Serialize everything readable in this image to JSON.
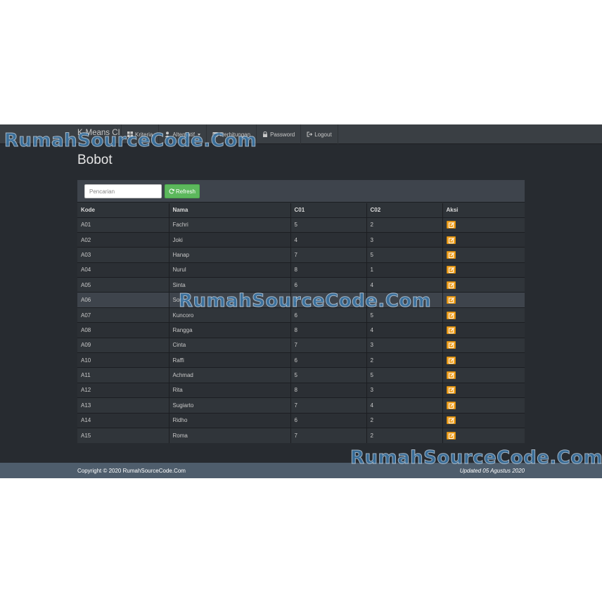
{
  "navbar": {
    "brand": "K-Means CI",
    "items": [
      {
        "label": "Kriteria",
        "icon": "th-large-icon"
      },
      {
        "label": "Alternatif",
        "icon": "user-icon",
        "dropdown": true
      },
      {
        "label": "Perhitungan",
        "icon": "calendar-icon"
      },
      {
        "label": "Password",
        "icon": "lock-icon"
      },
      {
        "label": "Logout",
        "icon": "logout-icon"
      }
    ]
  },
  "page": {
    "title": "Bobot"
  },
  "toolbar": {
    "search_placeholder": "Pencarian",
    "refresh_label": "Refresh"
  },
  "table": {
    "headers": [
      "Kode",
      "Nama",
      "C01",
      "C02",
      "Aksi"
    ],
    "rows": [
      [
        "A01",
        "Fachri",
        "5",
        "2"
      ],
      [
        "A02",
        "Joki",
        "4",
        "3"
      ],
      [
        "A03",
        "Hanap",
        "7",
        "5"
      ],
      [
        "A04",
        "Nurul",
        "8",
        "1"
      ],
      [
        "A05",
        "Sinta",
        "6",
        "4"
      ],
      [
        "A06",
        "Sony",
        "8",
        "2"
      ],
      [
        "A07",
        "Kuncoro",
        "6",
        "5"
      ],
      [
        "A08",
        "Rangga",
        "8",
        "4"
      ],
      [
        "A09",
        "Cinta",
        "7",
        "3"
      ],
      [
        "A10",
        "Raffi",
        "6",
        "2"
      ],
      [
        "A11",
        "Achmad",
        "5",
        "5"
      ],
      [
        "A12",
        "Rita",
        "8",
        "3"
      ],
      [
        "A13",
        "Sugiarto",
        "7",
        "4"
      ],
      [
        "A14",
        "Ridho",
        "6",
        "2"
      ],
      [
        "A15",
        "Roma",
        "7",
        "2"
      ]
    ]
  },
  "footer": {
    "copyright": "Copyright © 2020 RumahSourceCode.Com",
    "updated": "Updated 05 Agustus 2020"
  },
  "watermark": {
    "text": "RumahSourceCode.Com"
  },
  "colors": {
    "navbar": "#3a3f44",
    "body": "#272b30",
    "footer": "#4e5d6c",
    "refresh": "#5cb85c",
    "edit": "#f0a020"
  }
}
